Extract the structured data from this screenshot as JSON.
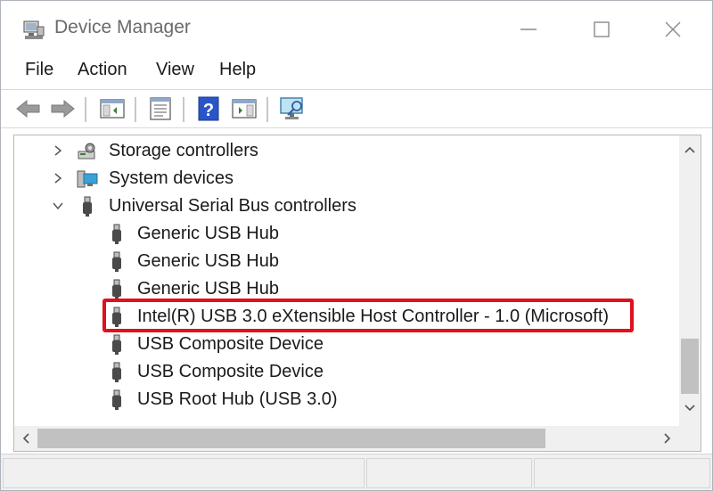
{
  "window": {
    "title": "Device Manager"
  },
  "menu": {
    "items": [
      "File",
      "Action",
      "View",
      "Help"
    ]
  },
  "toolbar": {
    "icons": [
      "back-arrow-icon",
      "forward-arrow-icon",
      "show-hide-console-tree-icon",
      "properties-icon",
      "help-icon",
      "run-action-icon",
      "scan-hardware-changes-icon"
    ]
  },
  "tree": {
    "items": [
      {
        "label": "Storage controllers",
        "level": 0,
        "expanded": false,
        "icon": "storage-controller-icon"
      },
      {
        "label": "System devices",
        "level": 0,
        "expanded": false,
        "icon": "system-devices-icon"
      },
      {
        "label": "Universal Serial Bus controllers",
        "level": 0,
        "expanded": true,
        "icon": "usb-icon"
      },
      {
        "label": "Generic USB Hub",
        "level": 1,
        "icon": "usb-device-icon"
      },
      {
        "label": "Generic USB Hub",
        "level": 1,
        "icon": "usb-device-icon"
      },
      {
        "label": "Generic USB Hub",
        "level": 1,
        "icon": "usb-device-icon"
      },
      {
        "label": "Intel(R) USB 3.0 eXtensible Host Controller - 1.0 (Microsoft)",
        "level": 1,
        "icon": "usb-device-icon",
        "highlighted": true
      },
      {
        "label": "USB Composite Device",
        "level": 1,
        "icon": "usb-device-icon"
      },
      {
        "label": "USB Composite Device",
        "level": 1,
        "icon": "usb-device-icon"
      },
      {
        "label": "USB Root Hub (USB 3.0)",
        "level": 1,
        "icon": "usb-device-icon"
      }
    ]
  },
  "colors": {
    "highlight": "#e0101d",
    "help_blue": "#2a55c9"
  }
}
